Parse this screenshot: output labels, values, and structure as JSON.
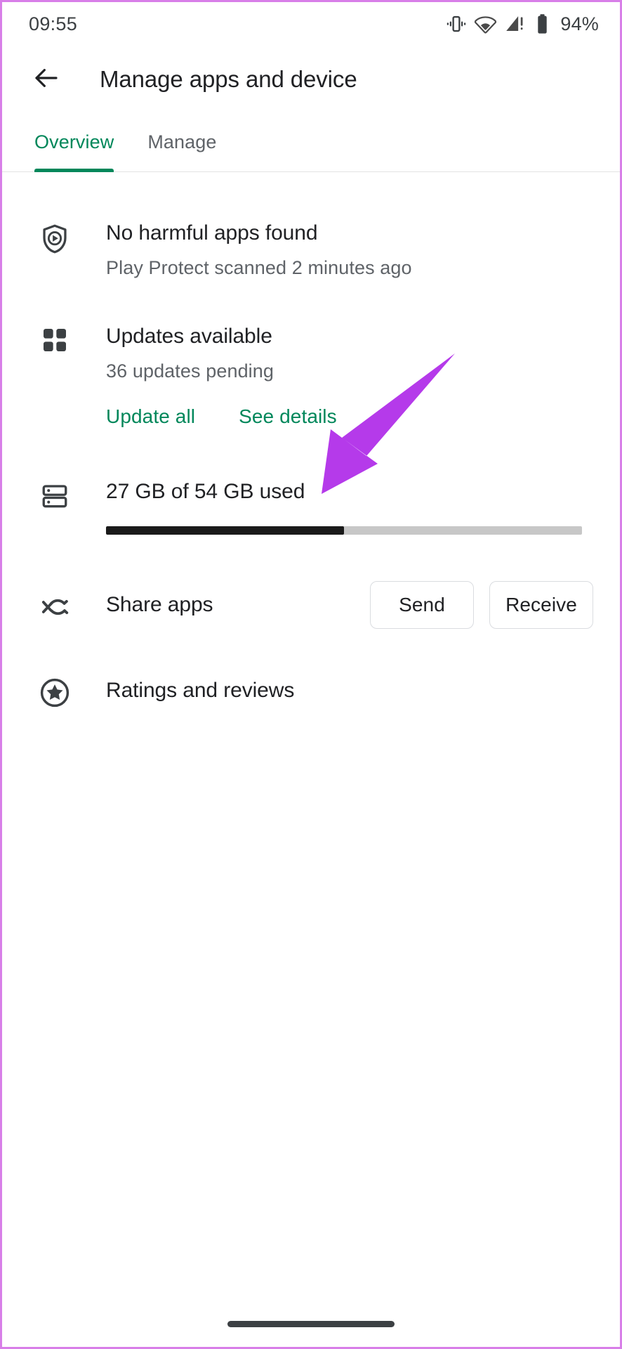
{
  "status_bar": {
    "time": "09:55",
    "battery_percent": "94%",
    "icons": [
      "vibrate-icon",
      "wifi-icon",
      "cellular-signal-alert-icon",
      "battery-icon"
    ]
  },
  "app_bar": {
    "back_icon": "arrow-back-icon",
    "title": "Manage apps and device"
  },
  "tabs": [
    {
      "label": "Overview",
      "active": true
    },
    {
      "label": "Manage",
      "active": false
    }
  ],
  "sections": {
    "play_protect": {
      "icon": "play-protect-shield-icon",
      "title": "No harmful apps found",
      "subtitle": "Play Protect scanned 2 minutes ago"
    },
    "updates": {
      "icon": "apps-grid-icon",
      "title": "Updates available",
      "subtitle": "36 updates pending",
      "update_all_label": "Update all",
      "see_details_label": "See details"
    },
    "storage": {
      "icon": "storage-icon",
      "title": "27 GB of 54 GB used",
      "used_gb": 27,
      "total_gb": 54,
      "percent_used": 50
    },
    "share_apps": {
      "icon": "share-apps-icon",
      "label": "Share apps",
      "send_label": "Send",
      "receive_label": "Receive"
    },
    "ratings": {
      "icon": "star-circle-icon",
      "label": "Ratings and reviews"
    }
  },
  "annotation": {
    "type": "arrow",
    "color": "#b53aea",
    "points_to": "See details"
  },
  "theme": {
    "accent_green": "#00875a",
    "text_primary": "#202124",
    "text_secondary": "#5f6368",
    "border": "#dadce0",
    "frame_purple": "#d87fe8"
  },
  "nav_pill": "home-indicator"
}
